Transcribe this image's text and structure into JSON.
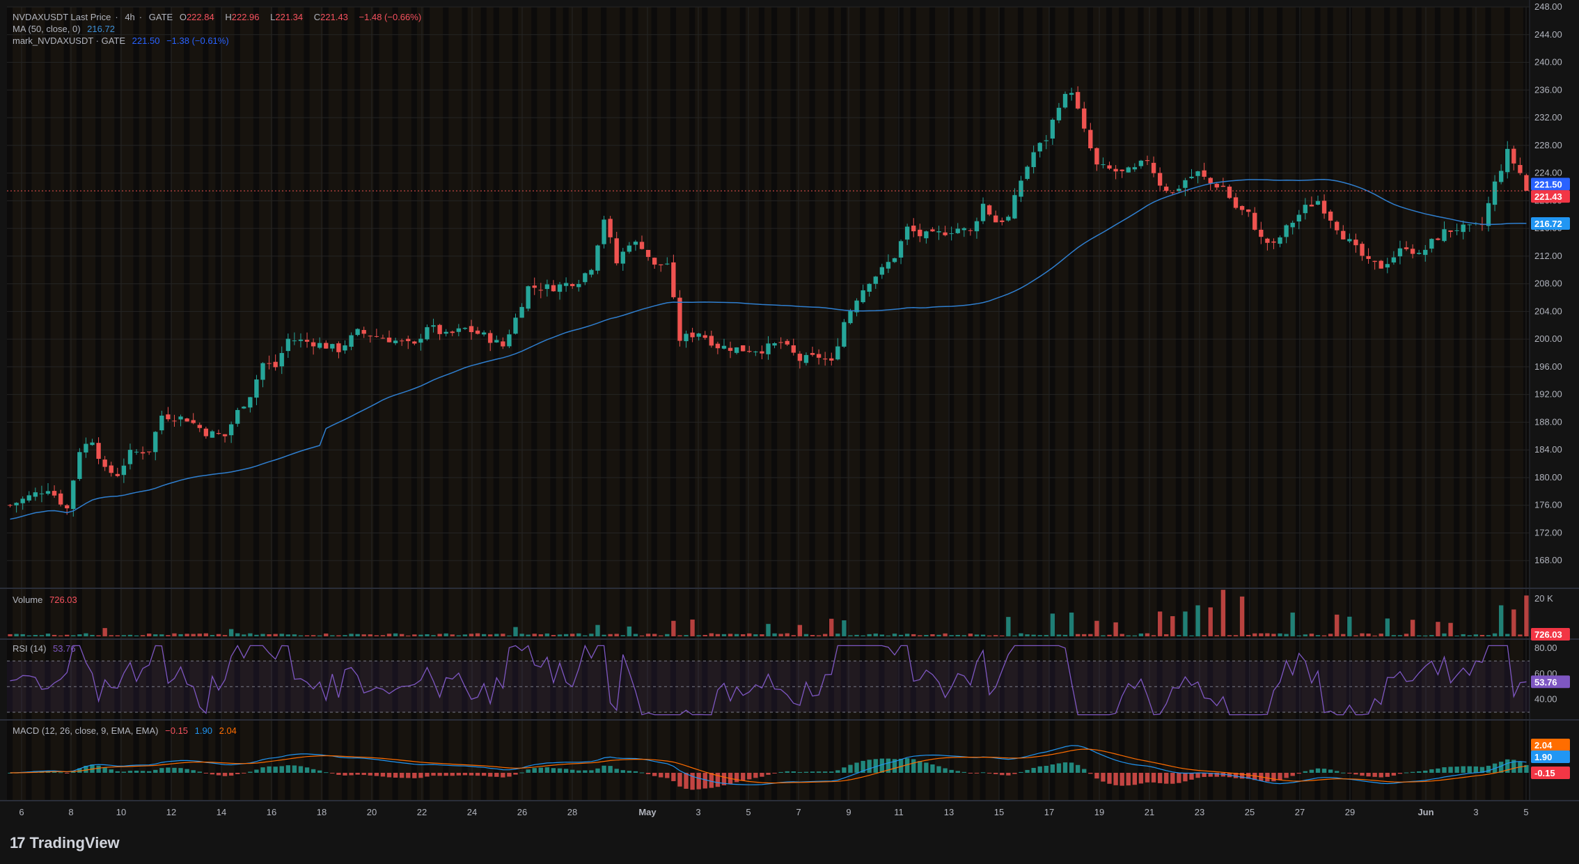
{
  "legend": {
    "symbol": "NVDAXUSDT Last Price",
    "interval": "4h",
    "exchange": "GATE",
    "o_label": "O",
    "o_value": "222.84",
    "h_label": "H",
    "h_value": "222.96",
    "l_label": "L",
    "l_value": "221.34",
    "c_label": "C",
    "c_value": "221.43",
    "change": "−1.48 (−0.66%)",
    "ma_label": "MA (50, close, 0)",
    "ma_value": "216.72",
    "mark_label": "mark_NVDAXUSDT · GATE",
    "mark_value": "221.50",
    "mark_change": "−1.38 (−0.61%)",
    "volume_label": "Volume",
    "volume_value": "726.03",
    "rsi_label": "RSI (14)",
    "rsi_value": "53.76",
    "macd_label": "MACD (12, 26, close, 9, EMA, EMA)",
    "macd_hist": "−0.15",
    "macd_line": "1.90",
    "macd_signal": "2.04"
  },
  "colors": {
    "up": "#26a69a",
    "down": "#ef5350",
    "ma": "#2f7fd0",
    "rsi": "#7e57c2",
    "macd": "#2196f3",
    "signal": "#ff6d00",
    "background": "#131313",
    "price_badge": "#f23645",
    "mark_badge": "#2962ff"
  },
  "icons": {
    "brand": "tradingview-logo-icon"
  },
  "footer": {
    "brand_name": "TradingView"
  },
  "chart_data": {
    "type": "candlestick",
    "symbol": "NVDAXUSDT",
    "interval": "4h",
    "ylim": [
      164,
      248
    ],
    "y_ticks": [
      "248.00",
      "244.00",
      "240.00",
      "236.00",
      "232.00",
      "228.00",
      "224.00",
      "220.00",
      "216.00",
      "212.00",
      "208.00",
      "204.00",
      "200.00",
      "196.00",
      "192.00",
      "188.00",
      "184.00",
      "180.00",
      "176.00",
      "172.00",
      "168.00"
    ],
    "x_ticks": [
      "6",
      "8",
      "10",
      "12",
      "14",
      "16",
      "18",
      "20",
      "22",
      "24",
      "26",
      "28",
      "May",
      "3",
      "5",
      "7",
      "9",
      "11",
      "13",
      "15",
      "17",
      "19",
      "21",
      "23",
      "25",
      "27",
      "29",
      "Jun",
      "3",
      "5"
    ],
    "bar_count": 174,
    "ma_period": 50,
    "ma_last": 216.72,
    "last_price": 221.43,
    "mark_price": 221.5,
    "approx_close_path": [
      [
        0,
        176
      ],
      [
        6,
        178.5
      ],
      [
        9,
        175.5
      ],
      [
        11,
        184
      ],
      [
        13,
        185.5
      ],
      [
        15,
        181
      ],
      [
        17,
        180.5
      ],
      [
        19,
        183.5
      ],
      [
        22,
        184
      ],
      [
        24,
        189
      ],
      [
        28,
        188.5
      ],
      [
        31,
        186.5
      ],
      [
        34,
        186
      ],
      [
        36,
        189.5
      ],
      [
        38,
        192
      ],
      [
        40,
        196.5
      ],
      [
        42,
        196
      ],
      [
        44,
        200
      ],
      [
        48,
        199.5
      ],
      [
        52,
        198.5
      ],
      [
        55,
        201
      ],
      [
        60,
        200
      ],
      [
        64,
        199
      ],
      [
        66,
        202
      ],
      [
        69,
        200.5
      ],
      [
        72,
        201.5
      ],
      [
        75,
        200.5
      ],
      [
        78,
        199
      ],
      [
        80,
        203
      ],
      [
        82,
        207.5
      ],
      [
        86,
        207.5
      ],
      [
        90,
        208.5
      ],
      [
        92,
        210.5
      ],
      [
        94,
        217.5
      ],
      [
        96,
        211
      ],
      [
        98,
        214
      ],
      [
        100,
        213.5
      ],
      [
        102,
        210.5
      ],
      [
        104,
        211
      ],
      [
        106,
        200
      ],
      [
        109,
        201
      ],
      [
        112,
        199
      ],
      [
        116,
        198.5
      ],
      [
        119,
        198.5
      ],
      [
        122,
        199.5
      ],
      [
        125,
        197
      ],
      [
        128,
        197.5
      ],
      [
        130,
        196.5
      ],
      [
        132,
        202.5
      ],
      [
        134,
        206
      ],
      [
        136,
        208.5
      ],
      [
        138,
        210
      ],
      [
        140,
        212
      ],
      [
        142,
        216
      ],
      [
        144,
        215
      ],
      [
        146,
        215
      ],
      [
        150,
        216
      ],
      [
        152,
        215.5
      ],
      [
        154,
        219.5
      ],
      [
        156,
        217
      ],
      [
        158,
        217.5
      ],
      [
        160,
        223
      ],
      [
        162,
        227
      ],
      [
        164,
        229
      ],
      [
        166,
        234
      ],
      [
        168,
        236
      ],
      [
        170,
        230
      ],
      [
        172,
        225
      ],
      [
        176,
        224
      ],
      [
        178,
        224.5
      ],
      [
        180,
        226
      ],
      [
        182,
        222.5
      ],
      [
        184,
        221
      ],
      [
        186,
        223
      ],
      [
        188,
        224
      ],
      [
        190,
        222.5
      ],
      [
        192,
        222
      ],
      [
        194,
        219
      ],
      [
        196,
        218
      ],
      [
        198,
        214.5
      ],
      [
        200,
        213.5
      ],
      [
        202,
        216
      ],
      [
        205,
        219
      ],
      [
        207,
        220
      ],
      [
        209,
        217.5
      ],
      [
        211,
        215
      ],
      [
        213,
        213
      ],
      [
        215,
        211
      ],
      [
        217,
        210.5
      ],
      [
        219,
        212
      ],
      [
        221,
        213.5
      ],
      [
        223,
        212
      ],
      [
        225,
        214
      ],
      [
        227,
        215.5
      ],
      [
        229,
        216
      ],
      [
        231,
        216
      ],
      [
        233,
        216.5
      ],
      [
        235,
        222.5
      ],
      [
        237,
        227
      ],
      [
        239,
        224
      ],
      [
        241,
        221.43
      ]
    ],
    "volume": {
      "label": "Volume",
      "last": 726.03,
      "axis_max_label": "20 K",
      "spikes": [
        [
          15,
          3200
        ],
        [
          35,
          2800
        ],
        [
          80,
          3600
        ],
        [
          93,
          4400
        ],
        [
          98,
          3800
        ],
        [
          105,
          6000
        ],
        [
          108,
          6500
        ],
        [
          120,
          4800
        ],
        [
          125,
          4400
        ],
        [
          130,
          6800
        ],
        [
          132,
          6200
        ],
        [
          158,
          7500
        ],
        [
          165,
          8800
        ],
        [
          168,
          9200
        ],
        [
          172,
          6000
        ],
        [
          175,
          5400
        ],
        [
          182,
          9600
        ],
        [
          184,
          7800
        ],
        [
          186,
          9600
        ],
        [
          188,
          12000
        ],
        [
          190,
          11200
        ],
        [
          192,
          18000
        ],
        [
          195,
          15400
        ],
        [
          203,
          9200
        ],
        [
          210,
          8400
        ],
        [
          212,
          7600
        ],
        [
          218,
          6900
        ],
        [
          222,
          6400
        ],
        [
          226,
          5600
        ],
        [
          228,
          5200
        ],
        [
          236,
          12000
        ],
        [
          238,
          10400
        ],
        [
          240,
          15800
        ]
      ]
    },
    "rsi": {
      "period": 14,
      "last": 53.76,
      "ticks": [
        "80.00",
        "60.00",
        "40.00"
      ],
      "bands": [
        70,
        50,
        30
      ],
      "ylim": [
        24,
        86
      ]
    },
    "macd": {
      "params": "12, 26, close, 9, EMA, EMA",
      "last_hist": -0.15,
      "last_macd": 1.9,
      "last_signal": 2.04
    }
  }
}
